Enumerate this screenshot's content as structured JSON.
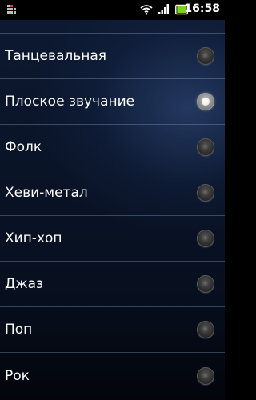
{
  "status_bar": {
    "time": "16:58",
    "icons": [
      "notification-icon",
      "wifi-icon",
      "signal-icon",
      "battery-icon"
    ],
    "battery_color": "#7ed321"
  },
  "equalizer_presets": {
    "items": [
      {
        "label": "Танцевальная",
        "selected": false
      },
      {
        "label": "Плоское звучание",
        "selected": true
      },
      {
        "label": "Фолк",
        "selected": false
      },
      {
        "label": "Хеви-метал",
        "selected": false
      },
      {
        "label": "Хип-хоп",
        "selected": false
      },
      {
        "label": "Джаз",
        "selected": false
      },
      {
        "label": "Поп",
        "selected": false
      },
      {
        "label": "Рок",
        "selected": false
      }
    ]
  }
}
